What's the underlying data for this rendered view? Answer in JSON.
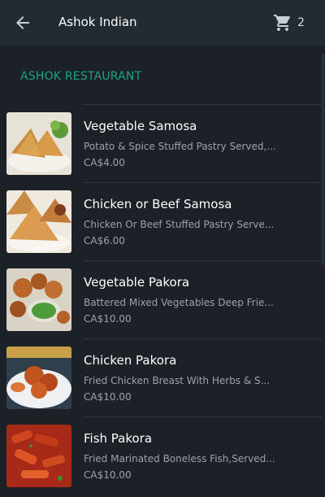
{
  "appbar": {
    "title": "Ashok Indian",
    "back_icon": "arrow-left-icon",
    "cart_icon": "cart-icon",
    "cart_count": "2"
  },
  "section": {
    "title": "ASHOK RESTAURANT",
    "accent_color": "#1aa37f"
  },
  "menu": {
    "items": [
      {
        "name": "Vegetable Samosa",
        "description": "Potato & Spice Stuffed Pastry Served,...",
        "price": "CA$4.00"
      },
      {
        "name": "Chicken or Beef Samosa",
        "description": "Chicken Or Beef Stuffed Pastry Serve...",
        "price": "CA$6.00"
      },
      {
        "name": "Vegetable Pakora",
        "description": "Battered Mixed Vegetables Deep Frie...",
        "price": "CA$10.00"
      },
      {
        "name": "Chicken Pakora",
        "description": "Fried Chicken Breast With Herbs & S...",
        "price": "CA$10.00"
      },
      {
        "name": "Fish Pakora",
        "description": "Fried Marinated Boneless Fish,Served...",
        "price": "CA$10.00"
      }
    ]
  }
}
